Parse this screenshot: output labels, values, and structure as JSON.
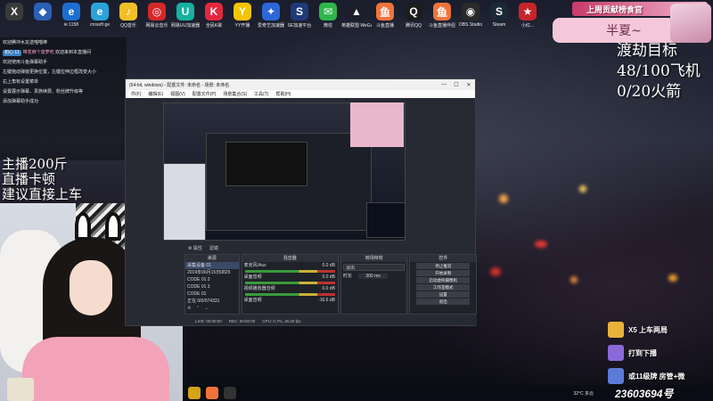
{
  "desktop_icons": [
    {
      "label": "",
      "color": "#3a3a3a",
      "glyph": "X"
    },
    {
      "label": "",
      "color": "#2b5fb4",
      "glyph": "◆"
    },
    {
      "label": "ie 1158",
      "color": "#1c6fd1",
      "glyph": "e"
    },
    {
      "label": "crosoft ge",
      "color": "#2aa3d8",
      "glyph": "e"
    },
    {
      "label": "QQ音乐",
      "color": "#f2c026",
      "glyph": "♪"
    },
    {
      "label": "网易云音乐",
      "color": "#d62828",
      "glyph": "◎"
    },
    {
      "label": "网易UU加速器",
      "color": "#18b0a0",
      "glyph": "U"
    },
    {
      "label": "全民K歌",
      "color": "#e4283e",
      "glyph": "K"
    },
    {
      "label": "YY开播",
      "color": "#f5c400",
      "glyph": "Y"
    },
    {
      "label": "爱奇艺加速器",
      "color": "#2d67d8",
      "glyph": "✦"
    },
    {
      "label": "SE加速平台",
      "color": "#203a7a",
      "glyph": "S"
    },
    {
      "label": "微信",
      "color": "#2fb64b",
      "glyph": "✉"
    },
    {
      "label": "英雄联盟 WeGame平台",
      "color": "#1b1f2a",
      "glyph": "▲"
    },
    {
      "label": "斗鱼直播",
      "color": "#f0733b",
      "glyph": "鱼"
    },
    {
      "label": "腾讯QQ",
      "color": "#1d1d1d",
      "glyph": "Q"
    },
    {
      "label": "斗鱼直播伴侣",
      "color": "#f0733b",
      "glyph": "鱼"
    },
    {
      "label": "OBS Studio",
      "color": "#2a2a2a",
      "glyph": "◉"
    },
    {
      "label": "Steam",
      "color": "#1b2838",
      "glyph": "S"
    },
    {
      "label": "小红...",
      "color": "#c8242c",
      "glyph": "★"
    }
  ],
  "chat": {
    "lines": [
      {
        "text": "欢迎腾冲水友送喵喵棒"
      },
      {
        "badge": "初心 11",
        "name": "带发麻个菠萝吃",
        "text": " 欢迎来到本直播间"
      },
      {
        "text": "欢迎使用斗鱼弹幕助手"
      },
      {
        "text": "左键拖动弹窗更换位置，左键拉伸边框改变大小"
      },
      {
        "text": "右上角有设置菜单"
      },
      {
        "text": "设置展示弹幕、贵族续费、粉丝牌升级等"
      },
      {
        "text": "添加弹幕助手成功"
      }
    ]
  },
  "left_overlay_text": [
    "主播200斤",
    "直播卡顿",
    "建议直接上车"
  ],
  "obs": {
    "title": "(64-bit, windows) - 配置文件: 未命名 - 场景: 未命名",
    "menu": [
      "件(F)",
      "编辑(E)",
      "视图(V)",
      "配置文件(P)",
      "场景集合(S)",
      "工具(T)",
      "帮助(H)"
    ],
    "source_bar": [
      "⚙ 属性",
      "滤镜"
    ],
    "scene_header": "来源",
    "sources": [
      "采集设备 01",
      "2019年06月15日0825",
      "CODE 01 2",
      "CODE 01 3",
      "CODE 01",
      "正在 0/0/074331"
    ],
    "mixer_header": "混音器",
    "mixer": [
      {
        "name": "麦克风/Aux",
        "db": "0.0 dB"
      },
      {
        "name": "桌面音频",
        "db": "0.0 dB"
      },
      {
        "name": "视频播放器音频",
        "db": "0.0 dB"
      }
    ],
    "mixer_bottom": {
      "name": "桌面音频",
      "db": "-16.6 dB"
    },
    "transition_header": "转场特效",
    "transition_type": "淡出",
    "transition_duration_label": "时长",
    "transition_duration": "300 ms",
    "controls_header": "控件",
    "controls": [
      "停止推流",
      "开始录制",
      "启动虚拟摄像机",
      "工作室模式",
      "设置",
      "退出"
    ],
    "status": {
      "live": "LIVE: 00:00:00",
      "rec": "REC: 00:00:00",
      "cpu": "CPU: 0.7%, 30.00 fps"
    }
  },
  "taskbar": {
    "weather": "32°C 多云",
    "icons": [
      {
        "name": "obs-taskbar-icon",
        "color": "#333"
      },
      {
        "name": "douyu-taskbar-icon",
        "color": "#f0733b"
      },
      {
        "name": "chrome-taskbar-icon",
        "color": "#d4a316"
      }
    ]
  },
  "top_right": {
    "banner": "上周贡献榜食官",
    "streamer_name": "半夏~",
    "goal_lines": [
      "渡劫目标",
      "48/100飞机",
      "0/20火箭"
    ]
  },
  "rules": [
    {
      "text": "X5 上车两局",
      "color": "#e8b23a"
    },
    {
      "text": "打到下播",
      "color": "#8a6ad8"
    },
    {
      "text": "或11级牌 房管+微",
      "color": "#5c7ad8"
    }
  ],
  "room_id": "23603694号"
}
